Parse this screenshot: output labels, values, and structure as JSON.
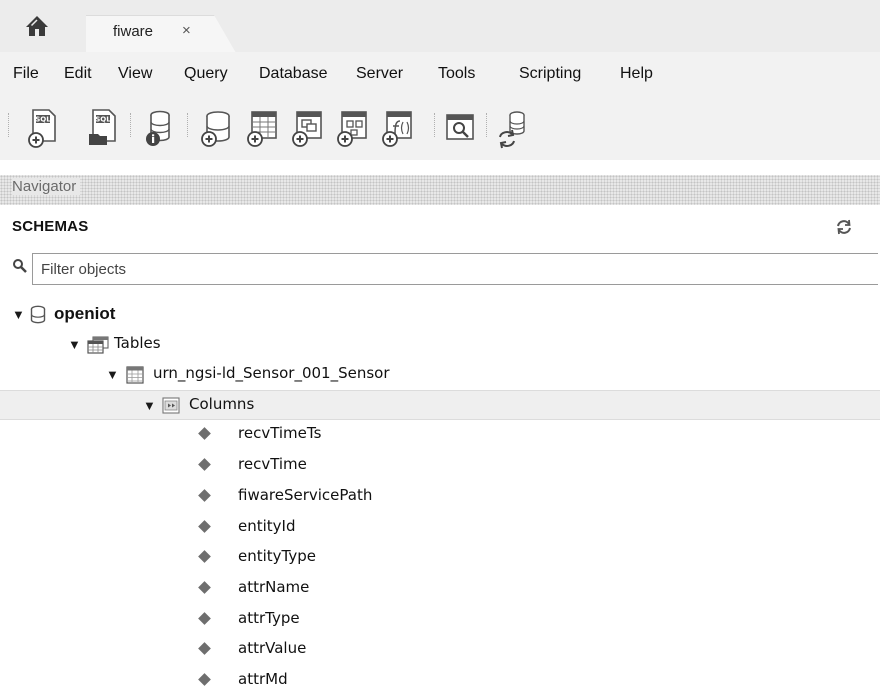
{
  "tabs": {
    "home_icon": "home-icon",
    "document_tab": {
      "label": "fiware",
      "close": "×"
    }
  },
  "menu": [
    "File",
    "Edit",
    "View",
    "Query",
    "Database",
    "Server",
    "Tools",
    "Scripting",
    "Help"
  ],
  "toolbar": {
    "new_sql_tab_icon_text": "SQL",
    "open_sql_script_icon_text": "SQL",
    "buttons": [
      "new-sql-tab-icon",
      "open-sql-script-icon",
      "schema-inspector-icon",
      "create-schema-icon",
      "create-table-icon",
      "create-view-icon",
      "create-procedure-icon",
      "create-function-icon",
      "search-table-data-icon",
      "reconnect-icon"
    ]
  },
  "navigator": {
    "header": "Navigator",
    "section_title": "SCHEMAS",
    "filter_placeholder": "Filter objects"
  },
  "tree": {
    "schema": "openiot",
    "tables_label": "Tables",
    "table": "urn_ngsi-ld_Sensor_001_Sensor",
    "columns_label": "Columns",
    "columns": [
      "recvTimeTs",
      "recvTime",
      "fiwareServicePath",
      "entityId",
      "entityType",
      "attrName",
      "attrType",
      "attrValue",
      "attrMd"
    ],
    "expand_glyph": "▼"
  },
  "colors": {
    "chrome_bg": "#f2f2f2",
    "tab_bar_bg": "#ececec",
    "selected_row_bg": "#efefef",
    "icon_gray": "#555555"
  }
}
